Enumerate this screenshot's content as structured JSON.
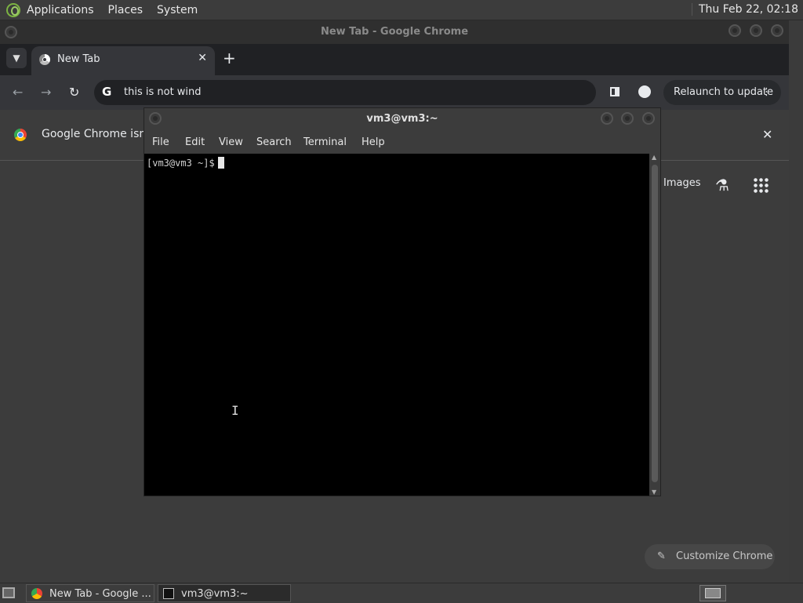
{
  "top_panel": {
    "menus": [
      "Applications",
      "Places",
      "System"
    ],
    "clock": "Thu Feb 22, 02:18"
  },
  "chrome": {
    "window_title": "New Tab - Google Chrome",
    "tab_title": "New Tab",
    "omnibox_text": "this is not wind",
    "relaunch_label": "Relaunch to update",
    "infobar_message": "Google Chrome isn't",
    "ntp_images_link": "Images",
    "customize_label": "Customize Chrome"
  },
  "terminal": {
    "title": "vm3@vm3:~",
    "menu": [
      "File",
      "Edit",
      "View",
      "Search",
      "Terminal",
      "Help"
    ],
    "prompt": "[vm3@vm3 ~]$"
  },
  "taskbar": {
    "tasks": [
      "New Tab - Google ...",
      "vm3@vm3:~"
    ]
  }
}
